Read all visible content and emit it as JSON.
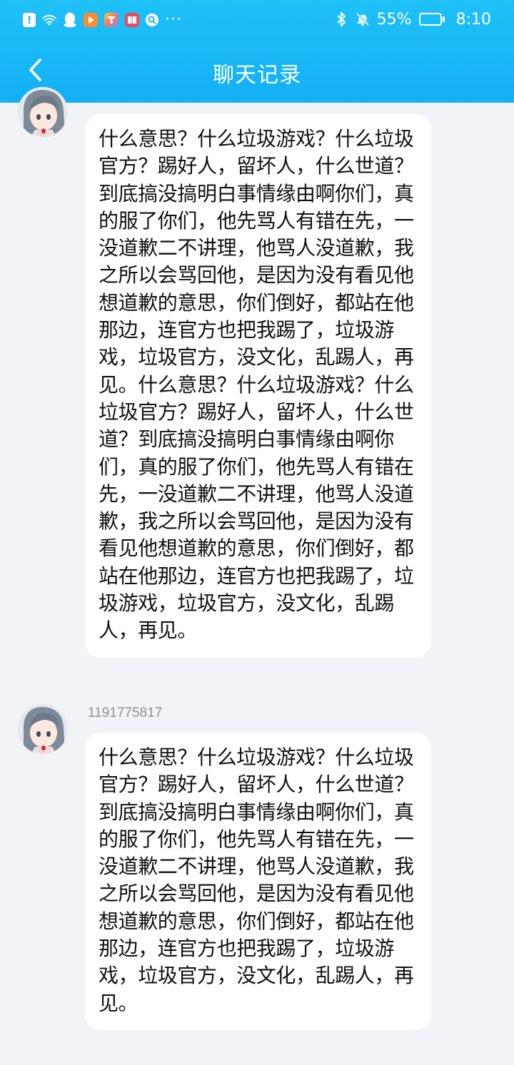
{
  "status_bar": {
    "battery_percent_text": "55%",
    "battery_level": 0.55,
    "time": "8:10",
    "left_icons": [
      "alert-icon",
      "wifi-icon",
      "qq-icon",
      "video-app-icon",
      "multicolor-app-icon",
      "book-app-icon",
      "search-app-icon",
      "more-dots-icon"
    ],
    "right_icons": [
      "bluetooth-icon",
      "mute-bell-icon",
      "battery-icon"
    ]
  },
  "header": {
    "title": "聊天记录",
    "back_icon": "chevron-left-icon"
  },
  "colors": {
    "header_gradient_top": "#1fc1f8",
    "header_gradient_bottom": "#13b0f5",
    "page_background": "#f2f3f7",
    "bubble_background": "#ffffff"
  },
  "messages": [
    {
      "sender": "",
      "text": "什么意思？什么垃圾游戏？什么垃圾官方？踢好人，留坏人，什么世道？到底搞没搞明白事情缘由啊你们，真的服了你们，他先骂人有错在先，一没道歉二不讲理，他骂人没道歉，我之所以会骂回他，是因为没有看见他想道歉的意思，你们倒好，都站在他那边，连官方也把我踢了，垃圾游戏，垃圾官方，没文化，乱踢人，再见。什么意思？什么垃圾游戏？什么垃圾官方？踢好人，留坏人，什么世道？到底搞没搞明白事情缘由啊你们，真的服了你们，他先骂人有错在先，一没道歉二不讲理，他骂人没道歉，我之所以会骂回他，是因为没有看见他想道歉的意思，你们倒好，都站在他那边，连官方也把我踢了，垃圾游戏，垃圾官方，没文化，乱踢人，再见。"
    },
    {
      "sender": "1191775817",
      "text": "什么意思？什么垃圾游戏？什么垃圾官方？踢好人，留坏人，什么世道？到底搞没搞明白事情缘由啊你们，真的服了你们，他先骂人有错在先，一没道歉二不讲理，他骂人没道歉，我之所以会骂回他，是因为没有看见他想道歉的意思，你们倒好，都站在他那边，连官方也把我踢了，垃圾游戏，垃圾官方，没文化，乱踢人，再见。"
    }
  ]
}
